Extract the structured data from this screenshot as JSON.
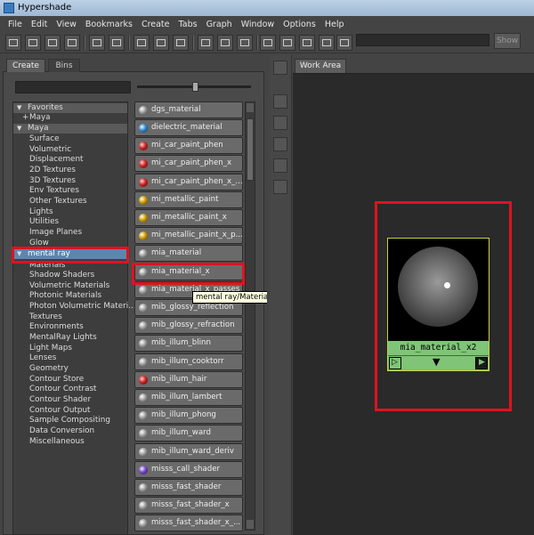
{
  "window": {
    "title": "Hypershade"
  },
  "menu": [
    "File",
    "Edit",
    "View",
    "Bookmarks",
    "Create",
    "Tabs",
    "Graph",
    "Window",
    "Options",
    "Help"
  ],
  "toolbar": {
    "show_label": "Show"
  },
  "left_tabs": {
    "create": "Create",
    "bins": "Bins"
  },
  "tree": {
    "favorites_header": "Favorites",
    "favorites_items": [
      "Maya"
    ],
    "maya_header": "Maya",
    "maya_items": [
      "Surface",
      "Volumetric",
      "Displacement",
      "2D Textures",
      "3D Textures",
      "Env Textures",
      "Other Textures",
      "Lights",
      "Utilities",
      "Image Planes",
      "Glow"
    ],
    "mentalray_header": "mental ray",
    "mentalray_items": [
      "Materials",
      "Shadow Shaders",
      "Volumetric Materials",
      "Photonic Materials",
      "Photon Volumetric Materi...",
      "Textures",
      "Environments",
      "MentalRay Lights",
      "Light Maps",
      "Lenses",
      "Geometry",
      "Contour Store",
      "Contour Contrast",
      "Contour Shader",
      "Contour Output",
      "Sample Compositing",
      "Data Conversion",
      "Miscellaneous"
    ]
  },
  "nodes": [
    {
      "label": "dgs_material",
      "ball": "plain"
    },
    {
      "label": "dielectric_material",
      "ball": "blue"
    },
    {
      "label": "mi_car_paint_phen",
      "ball": "red"
    },
    {
      "label": "mi_car_paint_phen_x",
      "ball": "red"
    },
    {
      "label": "mi_car_paint_phen_x_...",
      "ball": "red"
    },
    {
      "label": "mi_metallic_paint",
      "ball": "gold"
    },
    {
      "label": "mi_metallic_paint_x",
      "ball": "gold"
    },
    {
      "label": "mi_metallic_paint_x_p...",
      "ball": "gold"
    },
    {
      "label": "mia_material",
      "ball": "plain"
    },
    {
      "label": "mia_material_x",
      "ball": "plain"
    },
    {
      "label": "mia_material_x_passes",
      "ball": "plain"
    },
    {
      "label": "mib_glossy_reflection",
      "ball": "plain"
    },
    {
      "label": "mib_glossy_refraction",
      "ball": "plain"
    },
    {
      "label": "mib_illum_blinn",
      "ball": "plain"
    },
    {
      "label": "mib_illum_cooktorr",
      "ball": "plain"
    },
    {
      "label": "mib_illum_hair",
      "ball": "red"
    },
    {
      "label": "mib_illum_lambert",
      "ball": "plain"
    },
    {
      "label": "mib_illum_phong",
      "ball": "plain"
    },
    {
      "label": "mib_illum_ward",
      "ball": "plain"
    },
    {
      "label": "mib_illum_ward_deriv",
      "ball": "plain"
    },
    {
      "label": "misss_call_shader",
      "ball": "purple"
    },
    {
      "label": "misss_fast_shader",
      "ball": "plain"
    },
    {
      "label": "misss_fast_shader_x",
      "ball": "plain"
    },
    {
      "label": "misss_fast_shader_x_...",
      "ball": "plain"
    }
  ],
  "tooltip": "mental ray/Materials/mia_material_x",
  "work_area": {
    "tab_label": "Work Area",
    "node_name": "mia_material_x2"
  },
  "colors": {
    "highlight_red": "#e0121e",
    "node_green": "#7fc477",
    "selection_blue": "#5d85b0"
  }
}
